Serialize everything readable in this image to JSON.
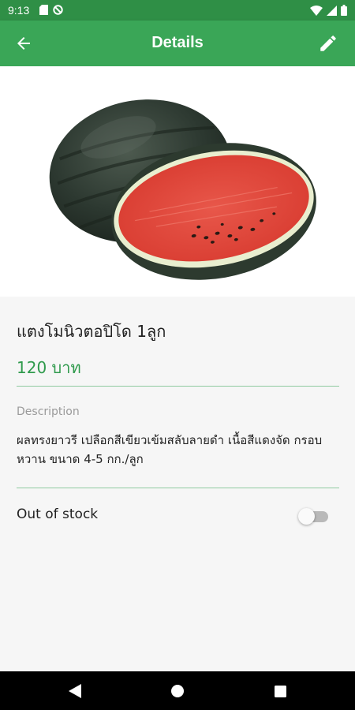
{
  "status_bar": {
    "time": "9:13",
    "left_icons": [
      "sd-card-icon",
      "no-disturb-icon"
    ],
    "right_icons": [
      "wifi-icon",
      "signal-icon",
      "battery-icon"
    ]
  },
  "app_bar": {
    "title": "Details",
    "back_icon": "arrow-back-icon",
    "edit_icon": "pencil-icon"
  },
  "product": {
    "image": "watermelon-image",
    "name": "แตงโมนิวตอปิโด 1ลูก",
    "price": "120 บาท",
    "description_label": "Description",
    "description": "ผลทรงยาวรี เปลือกสีเขียวเข้มสลับลายดำ เนื้อสีแดงจัด กรอบหวาน ขนาด 4-5 กก./ลูก",
    "out_of_stock_label": "Out of stock",
    "out_of_stock": false
  },
  "nav_bar": {
    "buttons": [
      "back-triangle-icon",
      "home-circle-icon",
      "recents-square-icon"
    ]
  },
  "colors": {
    "status_bar": "#2f8f46",
    "app_bar": "#3aa657",
    "price": "#2f9a4c",
    "divider": "#8fcaa0"
  }
}
